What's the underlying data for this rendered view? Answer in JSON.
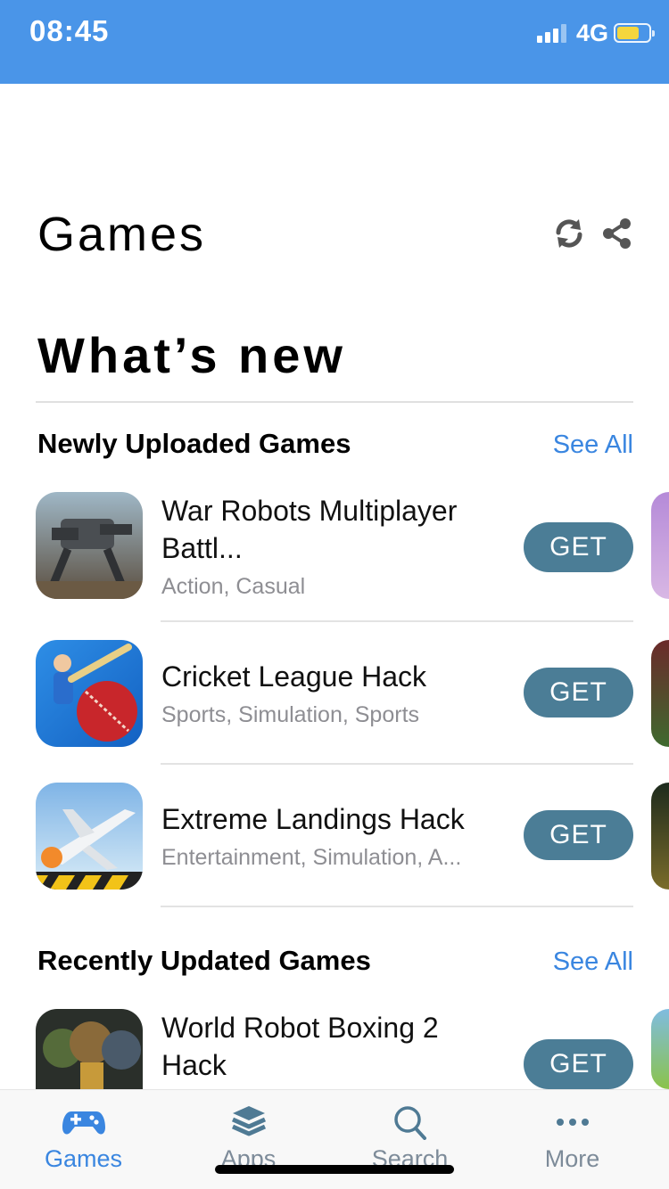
{
  "status": {
    "time": "08:45",
    "network": "4G"
  },
  "header": {
    "title": "Games",
    "refresh_icon": "refresh-icon",
    "share_icon": "share-icon"
  },
  "hero_title": "What’s new",
  "sections": {
    "newly_uploaded": {
      "title": "Newly Uploaded Games",
      "see_all": "See All",
      "apps": [
        {
          "name": "War Robots Multiplayer Battl...",
          "category": "Action, Casual",
          "button": "GET"
        },
        {
          "name": "Cricket League Hack",
          "category": "Sports, Simulation, Sports",
          "button": "GET"
        },
        {
          "name": "Extreme Landings Hack",
          "category": "Entertainment, Simulation, A...",
          "button": "GET"
        }
      ]
    },
    "recently_updated": {
      "title": "Recently Updated Games",
      "see_all": "See All",
      "apps": [
        {
          "name": "World Robot Boxing 2 Hack",
          "button": "GET"
        }
      ]
    }
  },
  "tabs": [
    {
      "label": "Games",
      "icon": "gamepad-icon",
      "active": true
    },
    {
      "label": "Apps",
      "icon": "layers-icon",
      "active": false
    },
    {
      "label": "Search",
      "icon": "search-icon",
      "active": false
    },
    {
      "label": "More",
      "icon": "more-dots-icon",
      "active": false
    }
  ],
  "colors": {
    "status_bar": "#4a95e8",
    "accent": "#3a86e0",
    "get_button": "#4b7d96",
    "secondary_text": "#8e8e93"
  }
}
